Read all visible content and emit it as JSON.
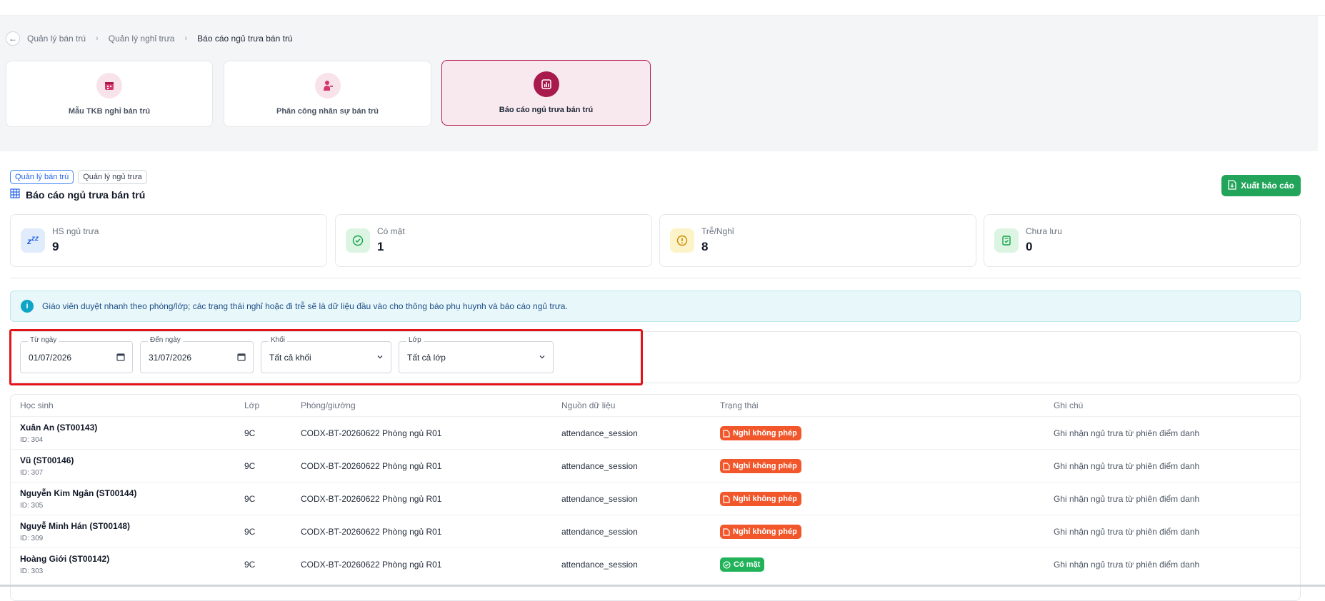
{
  "breadcrumb": {
    "items": [
      "Quản lý bán trú",
      "Quản lý nghỉ trưa"
    ],
    "current": "Báo cáo ngủ trưa bán trú"
  },
  "modules": [
    {
      "label": "Mẫu TKB nghỉ bán trú",
      "icon": "calendar-icon"
    },
    {
      "label": "Phân công nhân sự bán trú",
      "icon": "staff-assign-icon"
    },
    {
      "label": "Báo cáo ngủ trưa bán trú",
      "icon": "report-chart-icon"
    }
  ],
  "tags": [
    "Quản lý bán trú",
    "Quản lý ngủ trưa"
  ],
  "page_title": "Báo cáo ngủ trưa bán trú",
  "export_label": "Xuất báo cáo",
  "stats": [
    {
      "label": "HS ngủ trưa",
      "value": "9",
      "icon": "sleep-zzz-icon",
      "color": "#2563eb"
    },
    {
      "label": "Có mặt",
      "value": "1",
      "icon": "check-circle-icon",
      "color": "#16a34a"
    },
    {
      "label": "Trễ/Nghỉ",
      "value": "8",
      "icon": "warning-circle-icon",
      "color": "#ca8a04"
    },
    {
      "label": "Chưa lưu",
      "value": "0",
      "icon": "unsaved-doc-icon",
      "color": "#16a34a"
    }
  ],
  "info_text": "Giáo viên duyệt nhanh theo phòng/lớp; các trạng thái nghỉ hoặc đi trễ sẽ là dữ liệu đầu vào cho thông báo phụ huynh và báo cáo ngủ trưa.",
  "filters": {
    "from": {
      "label": "Từ ngày",
      "value": "01/07/2026"
    },
    "to": {
      "label": "Đến ngày",
      "value": "31/07/2026"
    },
    "grade": {
      "label": "Khối",
      "value": "Tất cả khối"
    },
    "class": {
      "label": "Lớp",
      "value": "Tất cả lớp"
    }
  },
  "table": {
    "headers": [
      "Học sinh",
      "Lớp",
      "Phòng/giường",
      "Nguồn dữ liệu",
      "Trạng thái",
      "Ghi chú"
    ],
    "rows": [
      {
        "name": "Xuân An (ST00143)",
        "id": "ID: 304",
        "class": "9C",
        "room": "CODX-BT-20260622 Phòng ngủ R01",
        "source": "attendance_session",
        "status": "Nghỉ không phép",
        "note": "Ghi nhận ngủ trưa từ phiên điểm danh"
      },
      {
        "name": "Vũ (ST00146)",
        "id": "ID: 307",
        "class": "9C",
        "room": "CODX-BT-20260622 Phòng ngủ R01",
        "source": "attendance_session",
        "status": "Nghỉ không phép",
        "note": "Ghi nhận ngủ trưa từ phiên điểm danh"
      },
      {
        "name": "Nguyễn Kim Ngân (ST00144)",
        "id": "ID: 305",
        "class": "9C",
        "room": "CODX-BT-20260622 Phòng ngủ R01",
        "source": "attendance_session",
        "status": "Nghỉ không phép",
        "note": "Ghi nhận ngủ trưa từ phiên điểm danh"
      },
      {
        "name": "Nguyễ Minh Hán (ST00148)",
        "id": "ID: 309",
        "class": "9C",
        "room": "CODX-BT-20260622 Phòng ngủ R01",
        "source": "attendance_session",
        "status": "Nghỉ không phép",
        "note": "Ghi nhận ngủ trưa từ phiên điểm danh"
      },
      {
        "name": "Hoàng Giới (ST00142)",
        "id": "ID: 303",
        "class": "9C",
        "room": "CODX-BT-20260622 Phòng ngủ R01",
        "source": "attendance_session",
        "status": "Có mặt",
        "note": "Ghi nhận ngủ trưa từ phiên điểm danh"
      }
    ]
  },
  "colors": {
    "accent": "#a8194c",
    "success": "#22a55b",
    "absent": "#f2572c",
    "highlight": "#e3131a"
  }
}
